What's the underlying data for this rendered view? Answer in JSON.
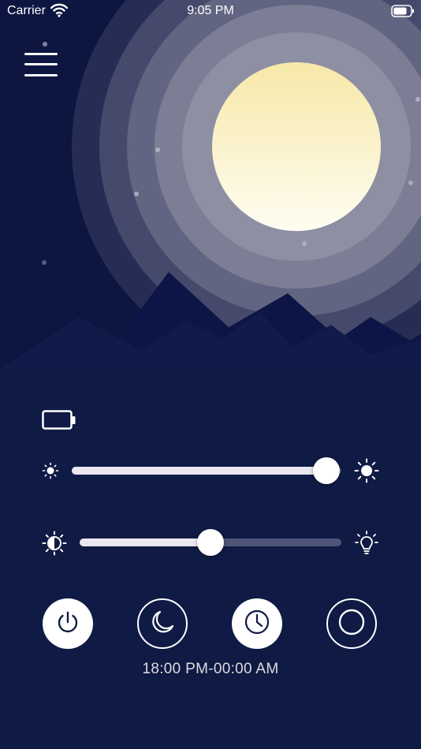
{
  "status_bar": {
    "carrier": "Carrier",
    "time": "9:05 PM"
  },
  "menu": {
    "icon": "hamburger-menu-icon"
  },
  "scene": {
    "moon_color": "#f8f1c8",
    "sky_color": "#0d1541"
  },
  "controls": {
    "battery_icon": "battery-icon",
    "brightness": {
      "min_icon": "sun-small-icon",
      "max_icon": "sun-large-icon",
      "level": 1.0
    },
    "color_temp": {
      "min_icon": "contrast-icon",
      "max_icon": "lightbulb-icon",
      "level": 0.5
    }
  },
  "modes": [
    {
      "name": "power",
      "icon": "power-icon",
      "style": "filled"
    },
    {
      "name": "night",
      "icon": "moon-icon",
      "style": "outline"
    },
    {
      "name": "timer",
      "icon": "clock-icon",
      "style": "filled"
    },
    {
      "name": "circle",
      "icon": "circle-icon",
      "style": "outline"
    }
  ],
  "schedule_text": "18:00 PM-00:00 AM",
  "accent": "#ffffff",
  "background": "#0f1a45"
}
